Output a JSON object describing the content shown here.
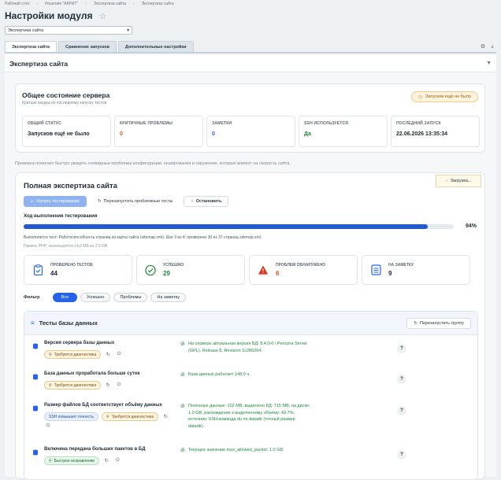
{
  "breadcrumb": [
    "Рабочий стол",
    "Решения \"АКРИТ\"",
    "Экспертиза сайта",
    "Экспертиза сайта"
  ],
  "page_title": "Настройки модуля",
  "module_select": "Экспертиза сайта",
  "tabs": [
    "Экспертиза сайта",
    "Сравнение запусков",
    "Дополнительные настройки"
  ],
  "section_title": "Экспертиза сайта",
  "server": {
    "title": "Общее состояние сервера",
    "subtitle": "Краткая сводка по последнему запуску тестов",
    "badge": "Запусков ещё не было",
    "stats": [
      {
        "label": "ОБЩИЙ СТАТУС",
        "value": "Запусков ещё не было",
        "color": "#1d2a36"
      },
      {
        "label": "КРИТИЧНЫЕ ПРОБЛЕМЫ",
        "value": "0",
        "color": "#e0541c"
      },
      {
        "label": "ЗАМЕТКИ",
        "value": "0",
        "color": "#2563eb"
      },
      {
        "label": "SSH ИСПОЛЬЗУЕТСЯ",
        "value": "Да",
        "color": "#1e8a3c"
      },
      {
        "label": "ПОСЛЕДНИЙ ЗАПУСК",
        "value": "22.06.2026 13:35:34",
        "color": "#1d2a36"
      }
    ]
  },
  "note": "Проверка помогает быстро увидеть очевидные проблемы конфигурации, кеширования и окружения, которые влияют на скорость сайта.",
  "audit": {
    "title": "Полная экспертиза сайта",
    "loading": "Загрузка...",
    "buttons": {
      "start": "Начать тестирование",
      "rerun": "Перезапустить проблемные тесты",
      "stop": "Остановить"
    },
    "progress_title": "Ход выполнения тестирования",
    "progress_percent": 94,
    "progress_label": "94%",
    "exec_text": "Выполняется тест: Работоспособность страниц из карты сайта (sitemap.xml). Шаг 3 из 4: проверено 30 из 37 страниц sitemap.xml.",
    "memory_text": "Память PHP: используется 14.0 MB из 2.0 GB.",
    "counts": [
      {
        "label": "ПРОВЕРЕНО ТЕСТОВ",
        "value": "44",
        "color": "#1d2a36",
        "icon": "clipboard-icon"
      },
      {
        "label": "УСПЕШНО",
        "value": "29",
        "color": "#1e8a3c",
        "icon": "check-circle-icon"
      },
      {
        "label": "ПРОБЛЕМ ОБНАРУЖЕНО",
        "value": "6",
        "color": "#e0541c",
        "icon": "warning-icon"
      },
      {
        "label": "НА ЗАМЕТКУ",
        "value": "9",
        "color": "#1d2a36",
        "icon": "list-icon"
      }
    ],
    "filter_label": "Фильтр",
    "filters": [
      "Все",
      "Успешно",
      "Проблемы",
      "На заметку"
    ]
  },
  "group": {
    "title": "Тесты базы данных",
    "rerun": "Перезапустить группу",
    "rows": [
      {
        "name": "Версия сервера базы данных",
        "tags": [
          {
            "text": "Требуется диагностика",
            "kind": "orange"
          }
        ],
        "result": [
          "На сервере актуальная версия БД: 8.4.0-0 / Percona Server",
          "(GPL), Release 8, Revision 1c286264."
        ]
      },
      {
        "name": "База данных проработала больше суток",
        "tags": [
          {
            "text": "Требуется диагностика",
            "kind": "orange"
          }
        ],
        "result": [
          "База данных работает 148.0 ч."
        ]
      },
      {
        "name": "Размер файлов БД соответствует объёму данных",
        "tags": [
          {
            "text": "SSH повышает точность",
            "kind": "blue"
          },
          {
            "text": "Требуется диагностика",
            "kind": "orange"
          }
        ],
        "result": [
          "Полезные данные: 102 MB, выделено БД: 715 MB, на диске:",
          "1.0 GB, расхождение к выделенному объёму: 43.7%,",
          "источник: SSH-команда du по datadir (точный размер",
          "datadir)."
        ]
      },
      {
        "name": "Включена передача больших пакетов в БД",
        "tags": [
          {
            "text": "Быстрое исправление",
            "kind": "green"
          }
        ],
        "result": [
          "Текущее значение max_allowed_packet: 1.0 GB."
        ]
      }
    ]
  }
}
